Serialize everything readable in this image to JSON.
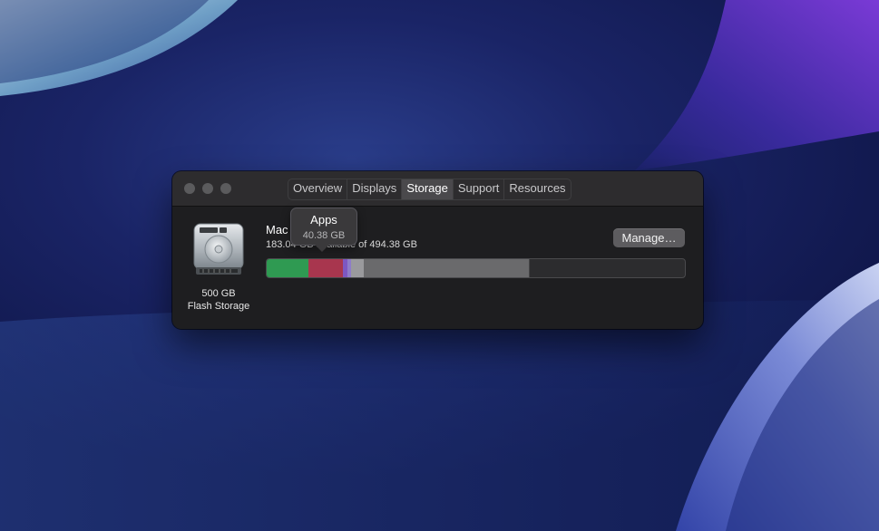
{
  "window": {
    "traffic_lights": [
      "close",
      "minimize",
      "zoom"
    ],
    "tabs": [
      {
        "label": "Overview",
        "active": false
      },
      {
        "label": "Displays",
        "active": false
      },
      {
        "label": "Storage",
        "active": true
      },
      {
        "label": "Support",
        "active": false
      },
      {
        "label": "Resources",
        "active": false
      }
    ]
  },
  "disk": {
    "icon": "hard-drive-icon",
    "capacity_label": "500 GB",
    "type_label": "Flash Storage"
  },
  "volume": {
    "name": "Mac",
    "availability": "183.04 GB available of 494.38 GB",
    "manage_label": "Manage…"
  },
  "storage_bar": {
    "segments": [
      {
        "category": "green",
        "percent": 10.0,
        "color": "#2f9a52"
      },
      {
        "category": "Apps",
        "percent": 8.2,
        "color": "#a8364e"
      },
      {
        "category": "purple",
        "percent": 1.2,
        "color": "#7d57c2"
      },
      {
        "category": "violet",
        "percent": 0.8,
        "color": "#8e7cc9"
      },
      {
        "category": "light-gray",
        "percent": 3.0,
        "color": "#9a9a9d"
      },
      {
        "category": "gray",
        "percent": 39.5,
        "color": "#6a6a6c"
      }
    ]
  },
  "tooltip": {
    "title": "Apps",
    "size": "40.38 GB"
  }
}
